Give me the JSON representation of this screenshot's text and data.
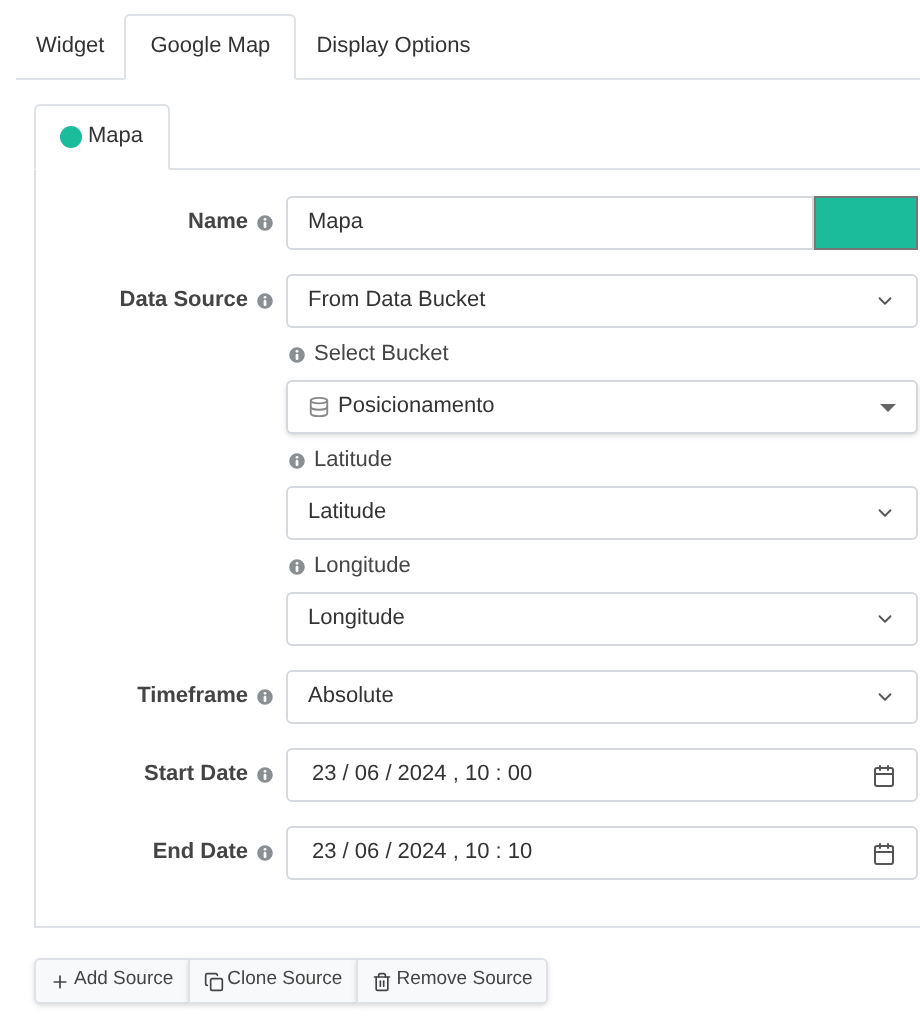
{
  "tabs": [
    {
      "label": "Widget",
      "selected": false
    },
    {
      "label": "Google Map",
      "selected": true
    },
    {
      "label": "Display Options",
      "selected": false
    }
  ],
  "source_tabs": [
    {
      "label": "Mapa",
      "color": "#1abc9c",
      "selected": true
    }
  ],
  "fields": [
    {
      "kind": "text",
      "label": "Name",
      "value": "Mapa",
      "color": "#1abc9c"
    },
    {
      "kind": "select",
      "label": "Data Source",
      "value": "From Data Bucket",
      "sub_fields": [
        {
          "kind": "bucket",
          "label": "Select Bucket",
          "value": "Posicionamento"
        },
        {
          "kind": "select",
          "label": "Latitude",
          "value": "Latitude"
        },
        {
          "kind": "select",
          "label": "Longitude",
          "value": "Longitude"
        }
      ]
    },
    {
      "kind": "select",
      "label": "Timeframe",
      "value": "Absolute"
    },
    {
      "kind": "date",
      "label": "Start Date",
      "value": "23 / 06 / 2024 ,  10 : 00"
    },
    {
      "kind": "date",
      "label": "End Date",
      "value": "23 / 06 / 2024 ,  10 : 10"
    }
  ],
  "buttons": [
    {
      "kind": "add",
      "label": "Add Source"
    },
    {
      "kind": "clone",
      "label": "Clone Source"
    },
    {
      "kind": "remove",
      "label": "Remove Source"
    }
  ]
}
